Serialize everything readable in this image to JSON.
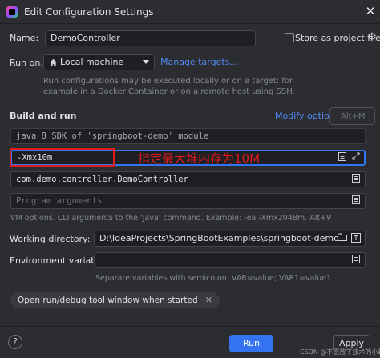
{
  "window": {
    "title": "Edit Configuration Settings",
    "close_glyph": "✕"
  },
  "name_row": {
    "label": "Name:",
    "value": "DemoController",
    "store_label": "Store as project file",
    "store_checked": false,
    "gear_glyph": "⚙"
  },
  "run_on": {
    "label": "Run on:",
    "target": "Local machine",
    "manage_link": "Manage targets...",
    "hint_line1": "Run configurations may be executed locally or on a target: for",
    "hint_line2": "example in a Docker Container or on a remote host using SSH."
  },
  "build_and_run": {
    "title": "Build and run",
    "modify_options": "Modify options",
    "modify_shortcut": "Alt+M",
    "jdk_value": "java 8  SDK of 'springboot-demo' module",
    "vm_options_value": "-Xmx10m",
    "vm_annotation": "指定最大堆内存为10M",
    "main_class_value": "com.demo.controller.DemoController",
    "program_args_placeholder": "Program arguments",
    "hint": "VM options. CLI arguments to the 'Java' command. Example: -ea -Xmx2048m. Alt+V"
  },
  "working_dir": {
    "label": "Working directory:",
    "value": "D:\\IdeaProjects\\SpringBootExamples\\springboot-demo"
  },
  "env_vars": {
    "label": "Environment variables:",
    "value": "",
    "hint": "Separate variables with semicolon: VAR=value; VAR1=value1"
  },
  "open_tool_window": {
    "label": "Open run/debug tool window when started",
    "remove_glyph": "✕"
  },
  "footer": {
    "help_glyph": "?",
    "run_label": "Run",
    "apply_label": "Apply",
    "watermark": "CSDN @不愿放下技术的小赵"
  },
  "colors": {
    "background": "#2b2d30",
    "accent": "#3574f0",
    "link": "#548af7",
    "annotation_red": "#e01b1b"
  }
}
